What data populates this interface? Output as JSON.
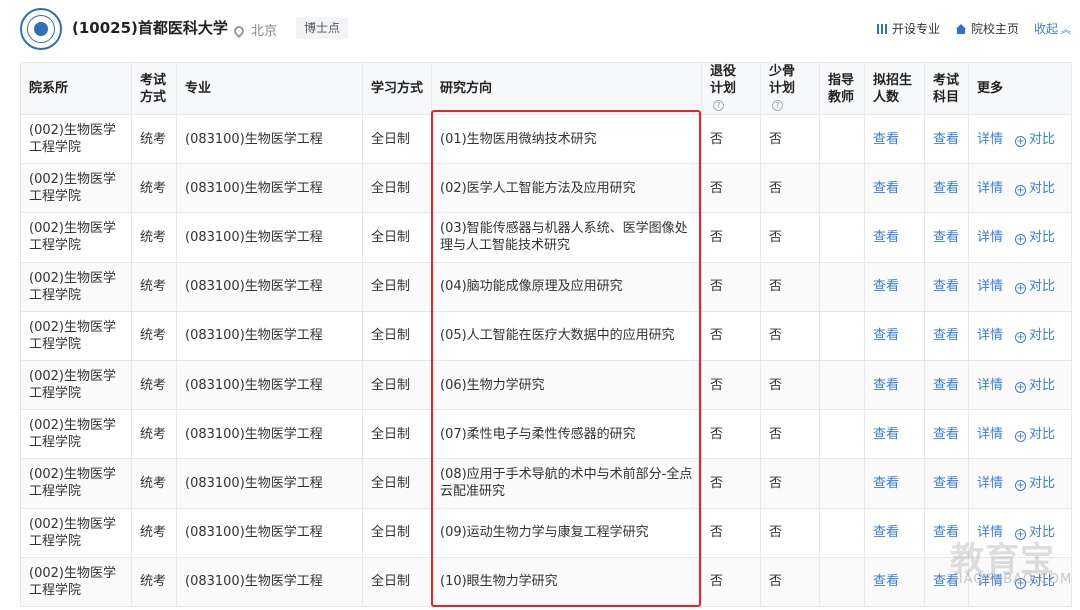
{
  "header": {
    "school_name": "(10025)首都医科大学",
    "location": "北京",
    "badge": "博士点",
    "link_majors": "开设专业",
    "link_homepage": "院校主页",
    "link_collapse": "收起"
  },
  "table": {
    "headers": {
      "department": "院系所",
      "exam_method": "考试方式",
      "major": "专业",
      "study_mode": "学习方式",
      "research_direction": "研究方向",
      "retired_plan": "退役计划",
      "minority_plan": "少骨计划",
      "supervisor": "指导教师",
      "enrollment": "拟招生人数",
      "exam_subjects": "考试科目",
      "more": "更多"
    },
    "rows": [
      {
        "department": "(002)生物医学工程学院",
        "exam_method": "统考",
        "major": "(083100)生物医学工程",
        "study_mode": "全日制",
        "research_direction": "(01)生物医用微纳技术研究",
        "retired_plan": "否",
        "minority_plan": "否",
        "supervisor": "",
        "enrollment": "查看",
        "exam_subjects": "查看",
        "details": "详情",
        "compare": "对比"
      },
      {
        "department": "(002)生物医学工程学院",
        "exam_method": "统考",
        "major": "(083100)生物医学工程",
        "study_mode": "全日制",
        "research_direction": "(02)医学人工智能方法及应用研究",
        "retired_plan": "否",
        "minority_plan": "否",
        "supervisor": "",
        "enrollment": "查看",
        "exam_subjects": "查看",
        "details": "详情",
        "compare": "对比"
      },
      {
        "department": "(002)生物医学工程学院",
        "exam_method": "统考",
        "major": "(083100)生物医学工程",
        "study_mode": "全日制",
        "research_direction": "(03)智能传感器与机器人系统、医学图像处理与人工智能技术研究",
        "retired_plan": "否",
        "minority_plan": "否",
        "supervisor": "",
        "enrollment": "查看",
        "exam_subjects": "查看",
        "details": "详情",
        "compare": "对比"
      },
      {
        "department": "(002)生物医学工程学院",
        "exam_method": "统考",
        "major": "(083100)生物医学工程",
        "study_mode": "全日制",
        "research_direction": "(04)脑功能成像原理及应用研究",
        "retired_plan": "否",
        "minority_plan": "否",
        "supervisor": "",
        "enrollment": "查看",
        "exam_subjects": "查看",
        "details": "详情",
        "compare": "对比"
      },
      {
        "department": "(002)生物医学工程学院",
        "exam_method": "统考",
        "major": "(083100)生物医学工程",
        "study_mode": "全日制",
        "research_direction": "(05)人工智能在医疗大数据中的应用研究",
        "retired_plan": "否",
        "minority_plan": "否",
        "supervisor": "",
        "enrollment": "查看",
        "exam_subjects": "查看",
        "details": "详情",
        "compare": "对比"
      },
      {
        "department": "(002)生物医学工程学院",
        "exam_method": "统考",
        "major": "(083100)生物医学工程",
        "study_mode": "全日制",
        "research_direction": "(06)生物力学研究",
        "retired_plan": "否",
        "minority_plan": "否",
        "supervisor": "",
        "enrollment": "查看",
        "exam_subjects": "查看",
        "details": "详情",
        "compare": "对比"
      },
      {
        "department": "(002)生物医学工程学院",
        "exam_method": "统考",
        "major": "(083100)生物医学工程",
        "study_mode": "全日制",
        "research_direction": "(07)柔性电子与柔性传感器的研究",
        "retired_plan": "否",
        "minority_plan": "否",
        "supervisor": "",
        "enrollment": "查看",
        "exam_subjects": "查看",
        "details": "详情",
        "compare": "对比"
      },
      {
        "department": "(002)生物医学工程学院",
        "exam_method": "统考",
        "major": "(083100)生物医学工程",
        "study_mode": "全日制",
        "research_direction": "(08)应用于手术导航的术中与术前部分-全点云配准研究",
        "retired_plan": "否",
        "minority_plan": "否",
        "supervisor": "",
        "enrollment": "查看",
        "exam_subjects": "查看",
        "details": "详情",
        "compare": "对比"
      },
      {
        "department": "(002)生物医学工程学院",
        "exam_method": "统考",
        "major": "(083100)生物医学工程",
        "study_mode": "全日制",
        "research_direction": "(09)运动生物力学与康复工程学研究",
        "retired_plan": "否",
        "minority_plan": "否",
        "supervisor": "",
        "enrollment": "查看",
        "exam_subjects": "查看",
        "details": "详情",
        "compare": "对比"
      },
      {
        "department": "(002)生物医学工程学院",
        "exam_method": "统考",
        "major": "(083100)生物医学工程",
        "study_mode": "全日制",
        "research_direction": "(10)眼生物力学研究",
        "retired_plan": "否",
        "minority_plan": "否",
        "supervisor": "",
        "enrollment": "查看",
        "exam_subjects": "查看",
        "details": "详情",
        "compare": "对比"
      }
    ]
  },
  "watermark": {
    "main": "教育宝",
    "sub": "JIAOYUBAO.COM"
  },
  "colors": {
    "link_blue": "#3a7de0",
    "highlight_red": "#e3262d",
    "header_bg": "#f7f8fa"
  }
}
